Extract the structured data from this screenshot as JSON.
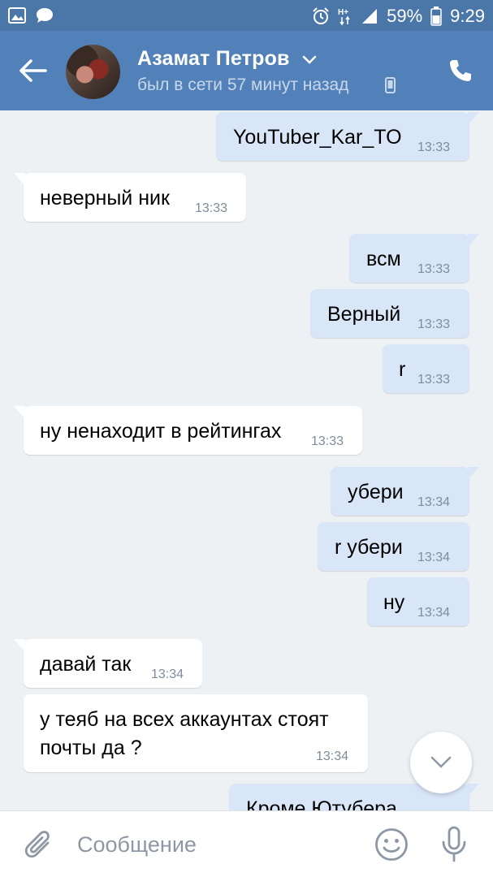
{
  "status_bar": {
    "battery": "59%",
    "time": "9:29",
    "icons": [
      "gallery-icon",
      "chat-notification-icon",
      "alarm-icon",
      "hplus-network-icon",
      "signal-icon",
      "battery-icon"
    ]
  },
  "header": {
    "contact_name": "Азамат Петров",
    "last_seen": "был в сети 57 минут назад"
  },
  "messages": [
    {
      "direction": "out",
      "text": "YouTuber_Kar_TO",
      "time": "13:33"
    },
    {
      "direction": "in",
      "text": "неверный ник",
      "time": "13:33"
    },
    {
      "direction": "out",
      "text": "всм",
      "time": "13:33"
    },
    {
      "direction": "out",
      "text": "Верный",
      "time": "13:33"
    },
    {
      "direction": "out",
      "text": "r",
      "time": "13:33"
    },
    {
      "direction": "in",
      "text": "ну ненаходит в рейтингах",
      "time": "13:33"
    },
    {
      "direction": "out",
      "text": "убери",
      "time": "13:34"
    },
    {
      "direction": "out",
      "text": "r убери",
      "time": "13:34"
    },
    {
      "direction": "out",
      "text": "ну",
      "time": "13:34"
    },
    {
      "direction": "in",
      "text": "давай так",
      "time": "13:34"
    },
    {
      "direction": "in",
      "text_lines": [
        "у теяб на всех аккаунтах стоят",
        "почты да ?"
      ],
      "time": "13:34"
    },
    {
      "direction": "out",
      "text": "Кроме Ютубера",
      "time": ""
    }
  ],
  "input": {
    "placeholder": "Сообщение"
  },
  "colors": {
    "header": "#5181b8",
    "status_bar": "#4a76a8",
    "background": "#eef1f4",
    "outgoing_bubble": "#d9e6f8",
    "incoming_bubble": "#ffffff",
    "icon_grey": "#8e98a4"
  }
}
